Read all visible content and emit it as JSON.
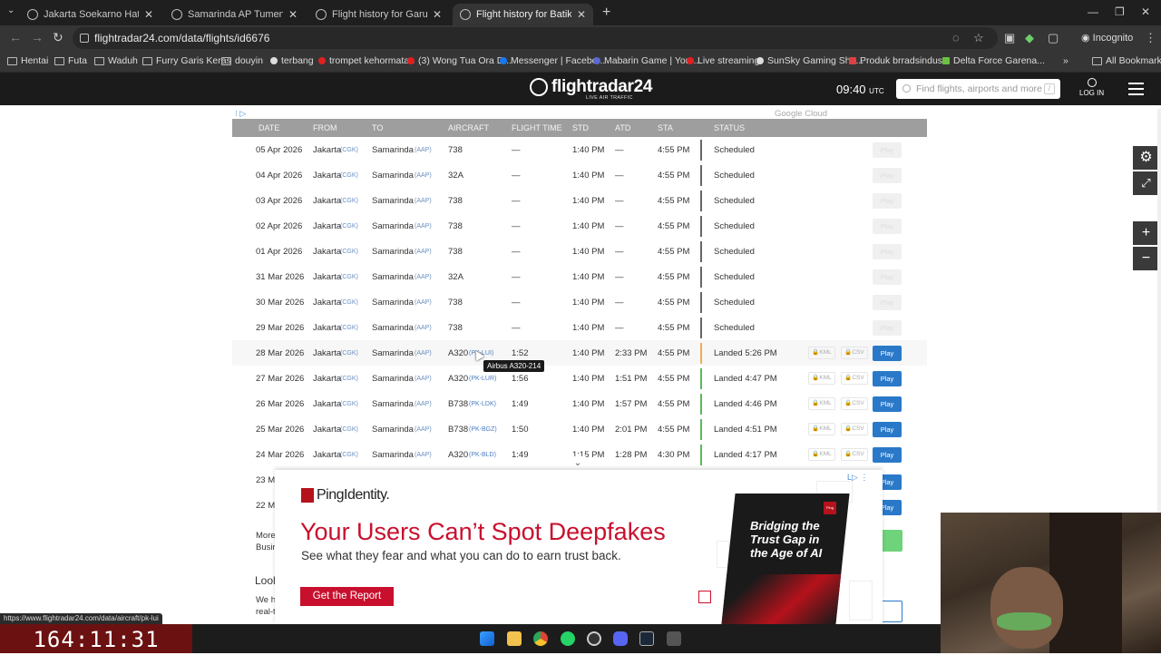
{
  "browser": {
    "tabs": [
      {
        "title": "Jakarta Soekarno Hatta Internat",
        "active": false
      },
      {
        "title": "Samarinda AP Tumenggung Pr",
        "active": false
      },
      {
        "title": "Flight history for Garuda Indon",
        "active": false
      },
      {
        "title": "Flight history for Batik Air flight",
        "active": true
      }
    ],
    "url": "flightradar24.com/data/flights/id6676",
    "profile": "Incognito",
    "bookmarks": [
      "Hentai",
      "Futa",
      "Waduh",
      "Furry Garis Keras",
      "douyin",
      "terbang",
      "trompet kehormatan",
      "(3) Wong Tua Ora D...",
      "Messenger | Facebo...",
      "Mabarin Game | You...",
      "Live streaming",
      "SunSky Gaming Sho...",
      "Produk brradsindus...",
      "Delta Force Garena..."
    ],
    "all_bookmarks": "All Bookmarks"
  },
  "site": {
    "logo": "flightradar24",
    "logo_sub": "LIVE AIR TRAFFIC",
    "time": "09:40",
    "time_zone": "UTC",
    "search_placeholder": "Find flights, airports and more",
    "search_key": "/",
    "login": "LOG IN"
  },
  "table": {
    "ad_label": "Google Cloud",
    "headers": [
      "DATE",
      "FROM",
      "TO",
      "AIRCRAFT",
      "FLIGHT TIME",
      "STD",
      "ATD",
      "STA",
      "STATUS"
    ],
    "rows": [
      {
        "date": "05 Apr 2026",
        "from": "Jakarta",
        "from_code": "(CGK)",
        "to": "Samarinda",
        "to_code": "(AAP)",
        "aircraft": "738",
        "reg": "",
        "flight_time": "—",
        "std": "1:40 PM",
        "atd": "—",
        "sta": "4:55 PM",
        "status": "Scheduled",
        "bar": "grey",
        "play": false
      },
      {
        "date": "04 Apr 2026",
        "from": "Jakarta",
        "from_code": "(CGK)",
        "to": "Samarinda",
        "to_code": "(AAP)",
        "aircraft": "32A",
        "reg": "",
        "flight_time": "—",
        "std": "1:40 PM",
        "atd": "—",
        "sta": "4:55 PM",
        "status": "Scheduled",
        "bar": "grey",
        "play": false
      },
      {
        "date": "03 Apr 2026",
        "from": "Jakarta",
        "from_code": "(CGK)",
        "to": "Samarinda",
        "to_code": "(AAP)",
        "aircraft": "738",
        "reg": "",
        "flight_time": "—",
        "std": "1:40 PM",
        "atd": "—",
        "sta": "4:55 PM",
        "status": "Scheduled",
        "bar": "grey",
        "play": false
      },
      {
        "date": "02 Apr 2026",
        "from": "Jakarta",
        "from_code": "(CGK)",
        "to": "Samarinda",
        "to_code": "(AAP)",
        "aircraft": "738",
        "reg": "",
        "flight_time": "—",
        "std": "1:40 PM",
        "atd": "—",
        "sta": "4:55 PM",
        "status": "Scheduled",
        "bar": "grey",
        "play": false
      },
      {
        "date": "01 Apr 2026",
        "from": "Jakarta",
        "from_code": "(CGK)",
        "to": "Samarinda",
        "to_code": "(AAP)",
        "aircraft": "738",
        "reg": "",
        "flight_time": "—",
        "std": "1:40 PM",
        "atd": "—",
        "sta": "4:55 PM",
        "status": "Scheduled",
        "bar": "grey",
        "play": false
      },
      {
        "date": "31 Mar 2026",
        "from": "Jakarta",
        "from_code": "(CGK)",
        "to": "Samarinda",
        "to_code": "(AAP)",
        "aircraft": "32A",
        "reg": "",
        "flight_time": "—",
        "std": "1:40 PM",
        "atd": "—",
        "sta": "4:55 PM",
        "status": "Scheduled",
        "bar": "grey",
        "play": false
      },
      {
        "date": "30 Mar 2026",
        "from": "Jakarta",
        "from_code": "(CGK)",
        "to": "Samarinda",
        "to_code": "(AAP)",
        "aircraft": "738",
        "reg": "",
        "flight_time": "—",
        "std": "1:40 PM",
        "atd": "—",
        "sta": "4:55 PM",
        "status": "Scheduled",
        "bar": "grey",
        "play": false
      },
      {
        "date": "29 Mar 2026",
        "from": "Jakarta",
        "from_code": "(CGK)",
        "to": "Samarinda",
        "to_code": "(AAP)",
        "aircraft": "738",
        "reg": "",
        "flight_time": "—",
        "std": "1:40 PM",
        "atd": "—",
        "sta": "4:55 PM",
        "status": "Scheduled",
        "bar": "grey",
        "play": false
      },
      {
        "date": "28 Mar 2026",
        "from": "Jakarta",
        "from_code": "(CGK)",
        "to": "Samarinda",
        "to_code": "(AAP)",
        "aircraft": "A320",
        "reg": "(PK-LUI)",
        "flight_time": "1:52",
        "std": "1:40 PM",
        "atd": "2:33 PM",
        "sta": "4:55 PM",
        "status": "Landed 5:26 PM",
        "bar": "amber",
        "play": true
      },
      {
        "date": "27 Mar 2026",
        "from": "Jakarta",
        "from_code": "(CGK)",
        "to": "Samarinda",
        "to_code": "(AAP)",
        "aircraft": "A320",
        "reg": "(PK-LUR)",
        "flight_time": "1:56",
        "std": "1:40 PM",
        "atd": "1:51 PM",
        "sta": "4:55 PM",
        "status": "Landed 4:47 PM",
        "bar": "green",
        "play": true
      },
      {
        "date": "26 Mar 2026",
        "from": "Jakarta",
        "from_code": "(CGK)",
        "to": "Samarinda",
        "to_code": "(AAP)",
        "aircraft": "B738",
        "reg": "(PK-LDK)",
        "flight_time": "1:49",
        "std": "1:40 PM",
        "atd": "1:57 PM",
        "sta": "4:55 PM",
        "status": "Landed 4:46 PM",
        "bar": "green",
        "play": true
      },
      {
        "date": "25 Mar 2026",
        "from": "Jakarta",
        "from_code": "(CGK)",
        "to": "Samarinda",
        "to_code": "(AAP)",
        "aircraft": "B738",
        "reg": "(PK-BGZ)",
        "flight_time": "1:50",
        "std": "1:40 PM",
        "atd": "2:01 PM",
        "sta": "4:55 PM",
        "status": "Landed 4:51 PM",
        "bar": "green",
        "play": true
      },
      {
        "date": "24 Mar 2026",
        "from": "Jakarta",
        "from_code": "(CGK)",
        "to": "Samarinda",
        "to_code": "(AAP)",
        "aircraft": "A320",
        "reg": "(PK-BLD)",
        "flight_time": "1:49",
        "std": "1:15 PM",
        "atd": "1:28 PM",
        "sta": "4:30 PM",
        "status": "Landed 4:17 PM",
        "bar": "green",
        "play": true
      }
    ],
    "partial_rows": [
      "23 Ma",
      "22 Ma"
    ],
    "kml": "KML",
    "csv": "CSV",
    "play": "Play",
    "tooltip": "Airbus A320-214",
    "more_text_1": "More",
    "more_text_2": "Busir",
    "look_heading": "Lool",
    "we_text_1": "We h",
    "we_text_2": "real-t"
  },
  "ad": {
    "brand": "PingIdentity.",
    "headline": "Your Users Can’t Spot Deepfakes",
    "subtext": "See what they fear and what you can do to earn trust back.",
    "cta": "Get the Report",
    "image_text": "Bridging the Trust Gap in the Age of AI",
    "image_tag": "Ping"
  },
  "status_url": "https://www.flightradar24.com/data/aircraft/pk-lui",
  "timer": "164:11:31",
  "colors": {
    "play_blue": "#2a79c9",
    "landed_green": "#5cb85c",
    "delayed_amber": "#f0ad4e",
    "ad_red": "#c8102e"
  }
}
